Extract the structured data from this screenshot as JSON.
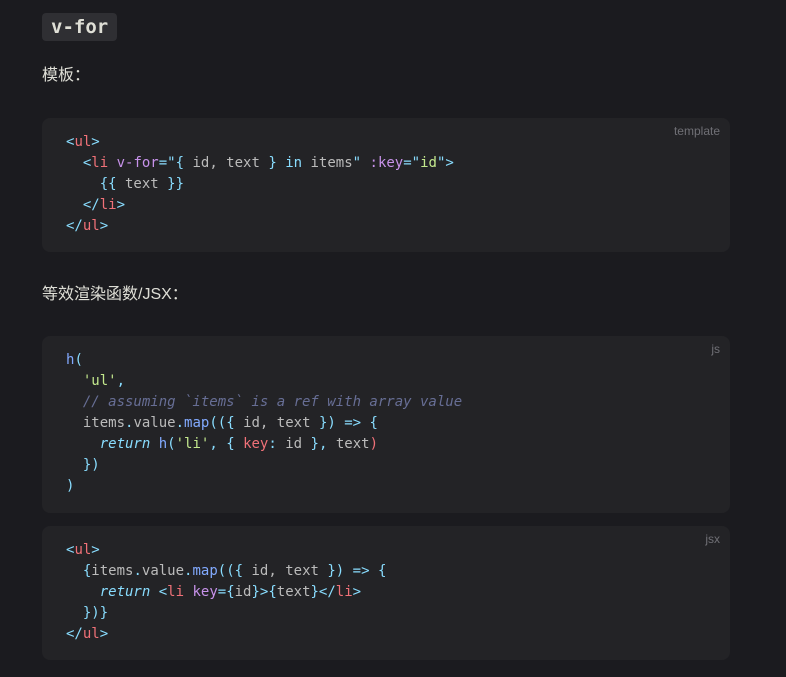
{
  "heading": "v-for",
  "para1": "模板：",
  "para2": "等效渲染函数/JSX：",
  "blocks": {
    "template": {
      "lang": "template"
    },
    "js": {
      "lang": "js"
    },
    "jsx": {
      "lang": "jsx"
    }
  },
  "code": {
    "template": [
      [
        [
          "tag-punc",
          "<"
        ],
        [
          "tag",
          "ul"
        ],
        [
          "tag-punc",
          ">"
        ]
      ],
      [
        [
          "plain",
          "  "
        ],
        [
          "tag-punc",
          "<"
        ],
        [
          "tag",
          "li"
        ],
        [
          "plain",
          " "
        ],
        [
          "attr",
          "v-for"
        ],
        [
          "tag-punc",
          "=\""
        ],
        [
          "tag-punc",
          "{ "
        ],
        [
          "plain",
          "id, text "
        ],
        [
          "tag-punc",
          "}"
        ],
        [
          "plain",
          " "
        ],
        [
          "kw",
          "in"
        ],
        [
          "plain",
          " items"
        ],
        [
          "tag-punc",
          "\""
        ],
        [
          "plain",
          " "
        ],
        [
          "attr",
          ":key"
        ],
        [
          "tag-punc",
          "=\""
        ],
        [
          "str",
          "id"
        ],
        [
          "tag-punc",
          "\">"
        ]
      ],
      [
        [
          "plain",
          "    "
        ],
        [
          "tag-punc",
          "{{"
        ],
        [
          "plain",
          " text "
        ],
        [
          "tag-punc",
          "}}"
        ]
      ],
      [
        [
          "plain",
          "  "
        ],
        [
          "tag-punc",
          "</"
        ],
        [
          "tag",
          "li"
        ],
        [
          "tag-punc",
          ">"
        ]
      ],
      [
        [
          "tag-punc",
          "</"
        ],
        [
          "tag",
          "ul"
        ],
        [
          "tag-punc",
          ">"
        ]
      ]
    ],
    "js": [
      [
        [
          "fn",
          "h"
        ],
        [
          "tag-punc",
          "("
        ]
      ],
      [
        [
          "plain",
          "  "
        ],
        [
          "str",
          "'ul'"
        ],
        [
          "tag-punc",
          ","
        ]
      ],
      [
        [
          "plain",
          "  "
        ],
        [
          "comment",
          "// assuming `items` is a ref with array value"
        ]
      ],
      [
        [
          "plain",
          "  items"
        ],
        [
          "tag-punc",
          "."
        ],
        [
          "plain",
          "value"
        ],
        [
          "tag-punc",
          "."
        ],
        [
          "fn",
          "map"
        ],
        [
          "tag-punc",
          "(({"
        ],
        [
          "plain",
          " id, text "
        ],
        [
          "tag-punc",
          "})"
        ],
        [
          "plain",
          " "
        ],
        [
          "kw",
          "=>"
        ],
        [
          "plain",
          " "
        ],
        [
          "tag-punc",
          "{"
        ]
      ],
      [
        [
          "plain",
          "    "
        ],
        [
          "ret",
          "return"
        ],
        [
          "plain",
          " "
        ],
        [
          "fn",
          "h"
        ],
        [
          "tag-punc",
          "("
        ],
        [
          "str",
          "'li'"
        ],
        [
          "tag-punc",
          ","
        ],
        [
          "plain",
          " "
        ],
        [
          "tag-punc",
          "{"
        ],
        [
          "plain",
          " "
        ],
        [
          "prop",
          "key"
        ],
        [
          "tag-punc",
          ":"
        ],
        [
          "plain",
          " id "
        ],
        [
          "tag-punc",
          "}"
        ],
        [
          "tag-punc",
          ","
        ],
        [
          "plain",
          " text"
        ],
        [
          "prop",
          ")"
        ]
      ],
      [
        [
          "plain",
          "  "
        ],
        [
          "tag-punc",
          "})"
        ]
      ],
      [
        [
          "tag-punc",
          ")"
        ]
      ]
    ],
    "jsx": [
      [
        [
          "tag-punc",
          "<"
        ],
        [
          "tag",
          "ul"
        ],
        [
          "tag-punc",
          ">"
        ]
      ],
      [
        [
          "plain",
          "  "
        ],
        [
          "tag-punc",
          "{"
        ],
        [
          "plain",
          "items"
        ],
        [
          "tag-punc",
          "."
        ],
        [
          "plain",
          "value"
        ],
        [
          "tag-punc",
          "."
        ],
        [
          "fn",
          "map"
        ],
        [
          "tag-punc",
          "(({"
        ],
        [
          "plain",
          " id, text "
        ],
        [
          "tag-punc",
          "})"
        ],
        [
          "plain",
          " "
        ],
        [
          "kw",
          "=>"
        ],
        [
          "plain",
          " "
        ],
        [
          "tag-punc",
          "{"
        ]
      ],
      [
        [
          "plain",
          "    "
        ],
        [
          "ret",
          "return"
        ],
        [
          "plain",
          " "
        ],
        [
          "tag-punc",
          "<"
        ],
        [
          "tag",
          "li"
        ],
        [
          "plain",
          " "
        ],
        [
          "attr",
          "key"
        ],
        [
          "tag-punc",
          "={"
        ],
        [
          "plain",
          "id"
        ],
        [
          "tag-punc",
          "}>{"
        ],
        [
          "plain",
          "text"
        ],
        [
          "tag-punc",
          "}</"
        ],
        [
          "tag",
          "li"
        ],
        [
          "tag-punc",
          ">"
        ]
      ],
      [
        [
          "plain",
          "  "
        ],
        [
          "tag-punc",
          "})}"
        ]
      ],
      [
        [
          "tag-punc",
          "</"
        ],
        [
          "tag",
          "ul"
        ],
        [
          "tag-punc",
          ">"
        ]
      ]
    ]
  }
}
